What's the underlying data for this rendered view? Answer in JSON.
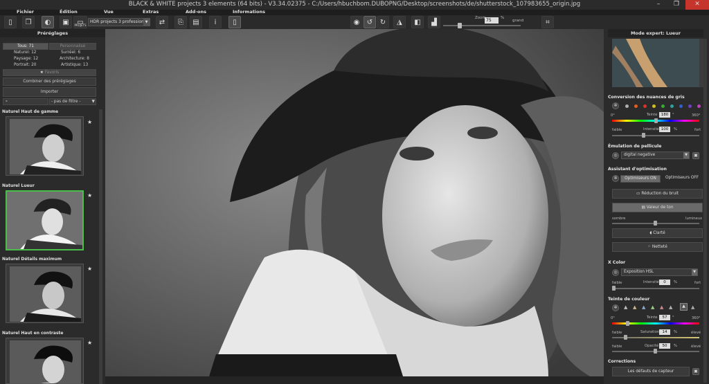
{
  "window": {
    "title": "BLACK & WHITE projects 3 elements (64 bits) - V3.34.02375 - C:/Users/hbuchbom.DUBOPNG/Desktop/screenshots/de/shutterstock_107983655_origin.jpg"
  },
  "menu": [
    "Fichier",
    "Édition",
    "Vue",
    "Extras",
    "Add-ons",
    "Informations"
  ],
  "toolbar": {
    "projects_label": "PROJETS",
    "hdr_select": "HDR projects 3 professional",
    "zoom_label": "Zoom",
    "zoom_value": "75",
    "zoom_unit": "%",
    "zoom_max_label": "grand",
    "zoom_fraction": 0.2
  },
  "left_panel": {
    "title": "Préréglages",
    "tabs": {
      "all": "Tous: 71",
      "custom": "Personnalisé"
    },
    "counts": [
      {
        "label": "Naturel: 12",
        "label2": "Surréel: 6"
      },
      {
        "label": "Paysage: 12",
        "label2": "Architecture: 8"
      },
      {
        "label": "Portrait: 20",
        "label2": "Artistique: 13"
      }
    ],
    "favorites": "Favoris",
    "combine": "Combiner des préréglages",
    "import": "Importer",
    "filter": "- pas de filtre -",
    "presets": [
      {
        "name": "Naturel Haut de gamme"
      },
      {
        "name": "Naturel Lueur"
      },
      {
        "name": "Naturel Détails maximum"
      },
      {
        "name": "Naturel Haut en contraste"
      }
    ],
    "star": "★"
  },
  "right_panel": {
    "title": "Mode expert: Lueur",
    "grayscale": {
      "title": "Conversion des nuances de gris",
      "hue_label": "Teinte",
      "hue_value": "180",
      "hue_unit": "°",
      "min_deg": "0°",
      "max_deg": "360°",
      "intensity_label": "Intensité",
      "intensity_value": "100",
      "intensity_unit": "%",
      "low": "faible",
      "high": "fort",
      "swatches": [
        "#d8a020",
        "#b0b0b0",
        "#e06020",
        "#e0302a",
        "#d0c020",
        "#30b030",
        "#30a0a0",
        "#3060d0",
        "#7040c0",
        "#c040c0"
      ]
    },
    "film": {
      "title": "Émulation de pellicule",
      "value": "digital negative"
    },
    "optimize": {
      "title": "Assistant d'optimisation",
      "on": "Optimiseurs ON",
      "off": "Optimiseurs OFF",
      "noise": "Réduction du bruit",
      "tone": "Valeur de ton",
      "dark": "sombre",
      "bright": "lumineux",
      "clarity": "Clarté",
      "sharpness": "Netteté"
    },
    "xcolor": {
      "title": "X Color",
      "value": "Exposition HSL",
      "intensity_label": "Intensité",
      "intensity_value": "0",
      "unit": "%",
      "low": "faible",
      "high": "fort"
    },
    "tint": {
      "title": "Teinte de couleur",
      "hue_label": "Teinte",
      "hue_value": "57",
      "hue_unit": "°",
      "min_deg": "0°",
      "max_deg": "360°",
      "saturation_label": "Saturation",
      "saturation_value": "14",
      "opacity_label": "Opacité",
      "opacity_value": "50",
      "unit": "%",
      "low": "faible",
      "high": "élevé"
    },
    "corrections": {
      "title": "Corrections",
      "sensor": "Les défauts de capteur"
    }
  }
}
